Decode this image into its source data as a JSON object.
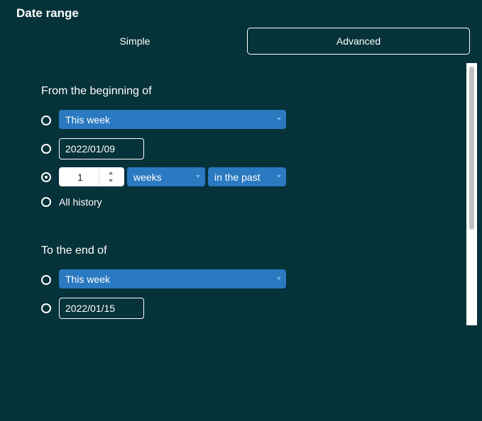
{
  "header": {
    "title": "Date range"
  },
  "tabs": {
    "simple": "Simple",
    "advanced": "Advanced"
  },
  "from": {
    "heading": "From the beginning of",
    "period_select": "This week",
    "date_value": "2022/01/09",
    "count_value": "1",
    "unit_select": "weeks",
    "direction_select": "in the past",
    "all_history_label": "All history",
    "selected_option": "relative"
  },
  "to": {
    "heading": "To the end of",
    "period_select": "This week",
    "date_value": "2022/01/15"
  },
  "colors": {
    "background": "#063239",
    "select": "#2a79c1",
    "text": "#ffffff"
  }
}
